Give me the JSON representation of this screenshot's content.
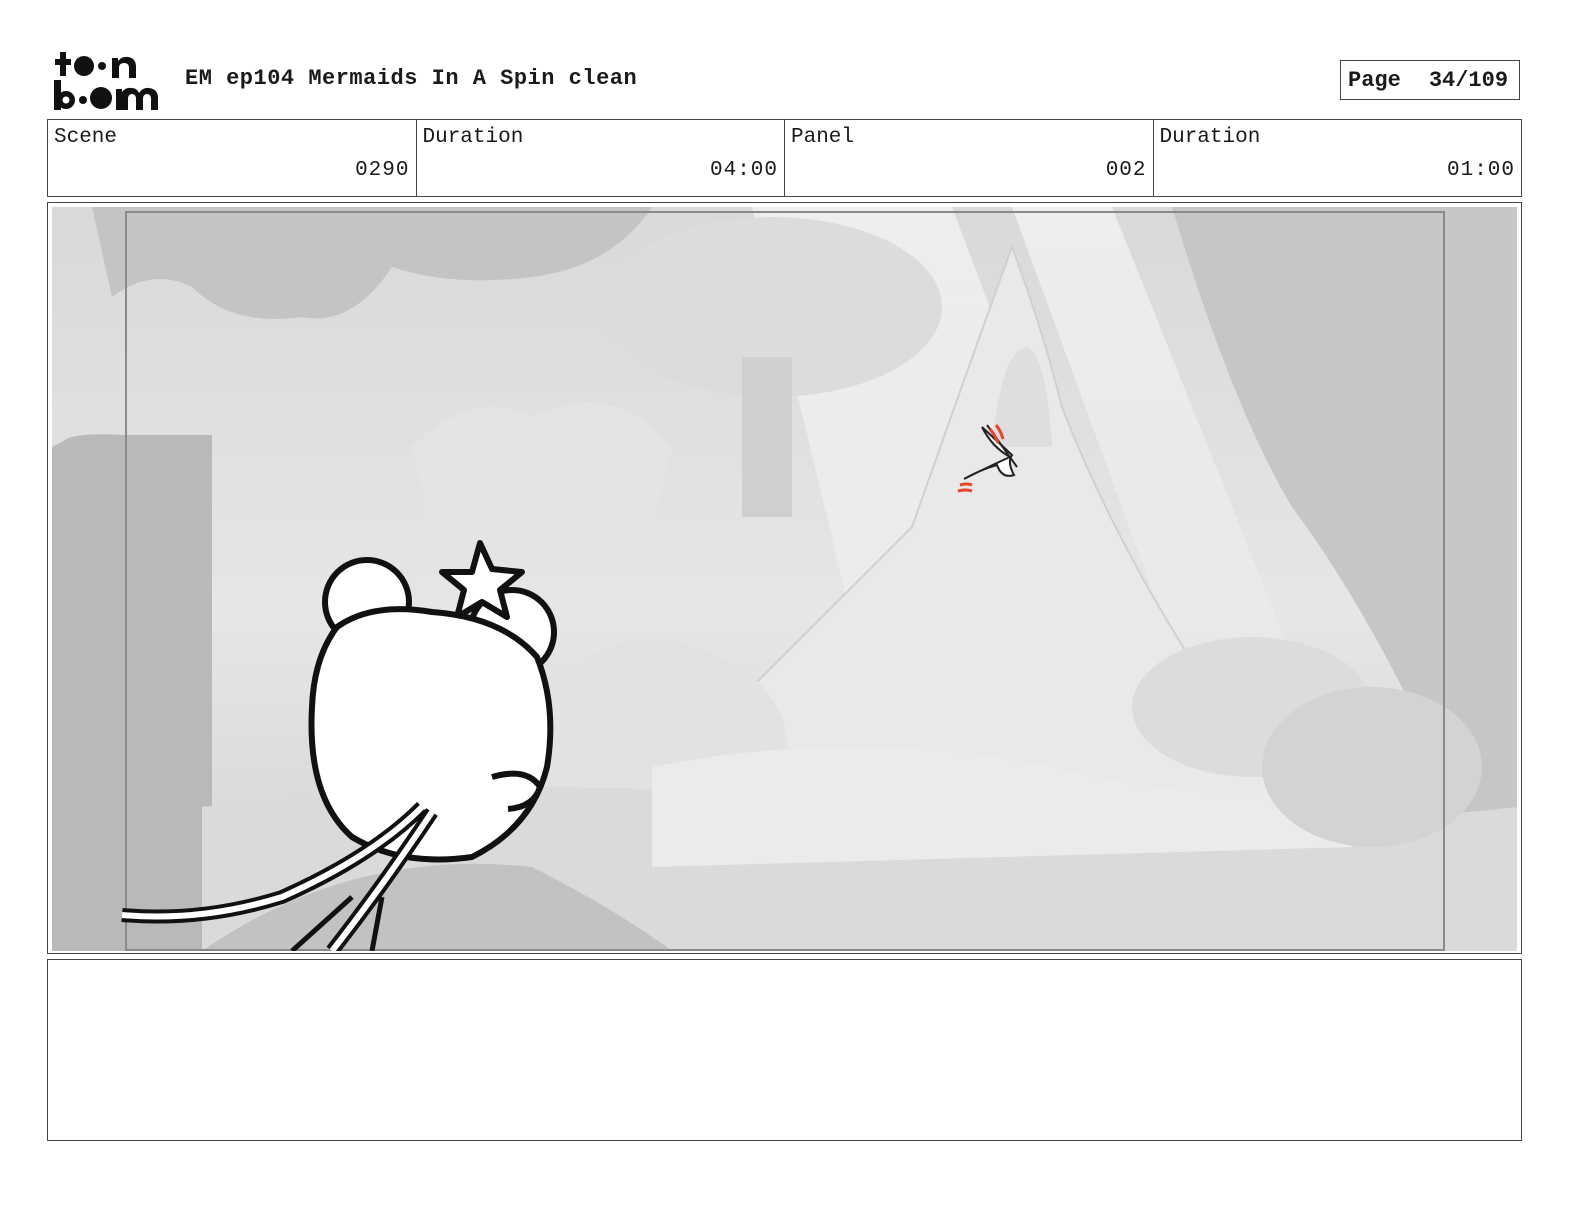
{
  "header": {
    "logo_top": "toon",
    "logo_bottom": "boom",
    "title": "EM ep104 Mermaids In A Spin clean",
    "page_label": "Page",
    "page_value": "34/109"
  },
  "info": {
    "scene_label": "Scene",
    "scene_value": "0290",
    "scene_duration_label": "Duration",
    "scene_duration_value": "04:00",
    "panel_label": "Panel",
    "panel_value": "002",
    "panel_duration_label": "Duration",
    "panel_duration_value": "01:00"
  },
  "panel": {
    "background_tone": "#cfcfcf",
    "accent_color": "#e8452a"
  },
  "notes": {
    "text": ""
  }
}
